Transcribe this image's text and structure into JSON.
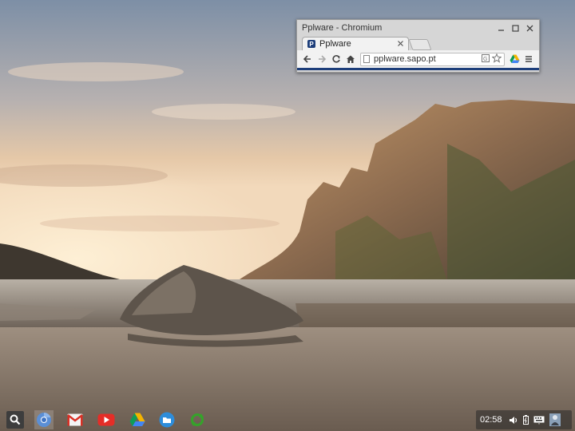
{
  "browser": {
    "window_title": "Pplware - Chromium",
    "tab": {
      "title": "Pplware",
      "favicon_letter": "P"
    },
    "omnibox": {
      "url": "pplware.sapo.pt"
    },
    "accent_color": "#1d3e7a"
  },
  "shelf": {
    "apps": [
      {
        "name": "chromium",
        "icon": "chromium-icon"
      },
      {
        "name": "gmail",
        "icon": "gmail-icon"
      },
      {
        "name": "youtube",
        "icon": "youtube-icon"
      },
      {
        "name": "drive",
        "icon": "drive-icon"
      },
      {
        "name": "files",
        "icon": "files-icon"
      },
      {
        "name": "sync",
        "icon": "sync-icon"
      }
    ],
    "status": {
      "time": "02:58"
    }
  }
}
